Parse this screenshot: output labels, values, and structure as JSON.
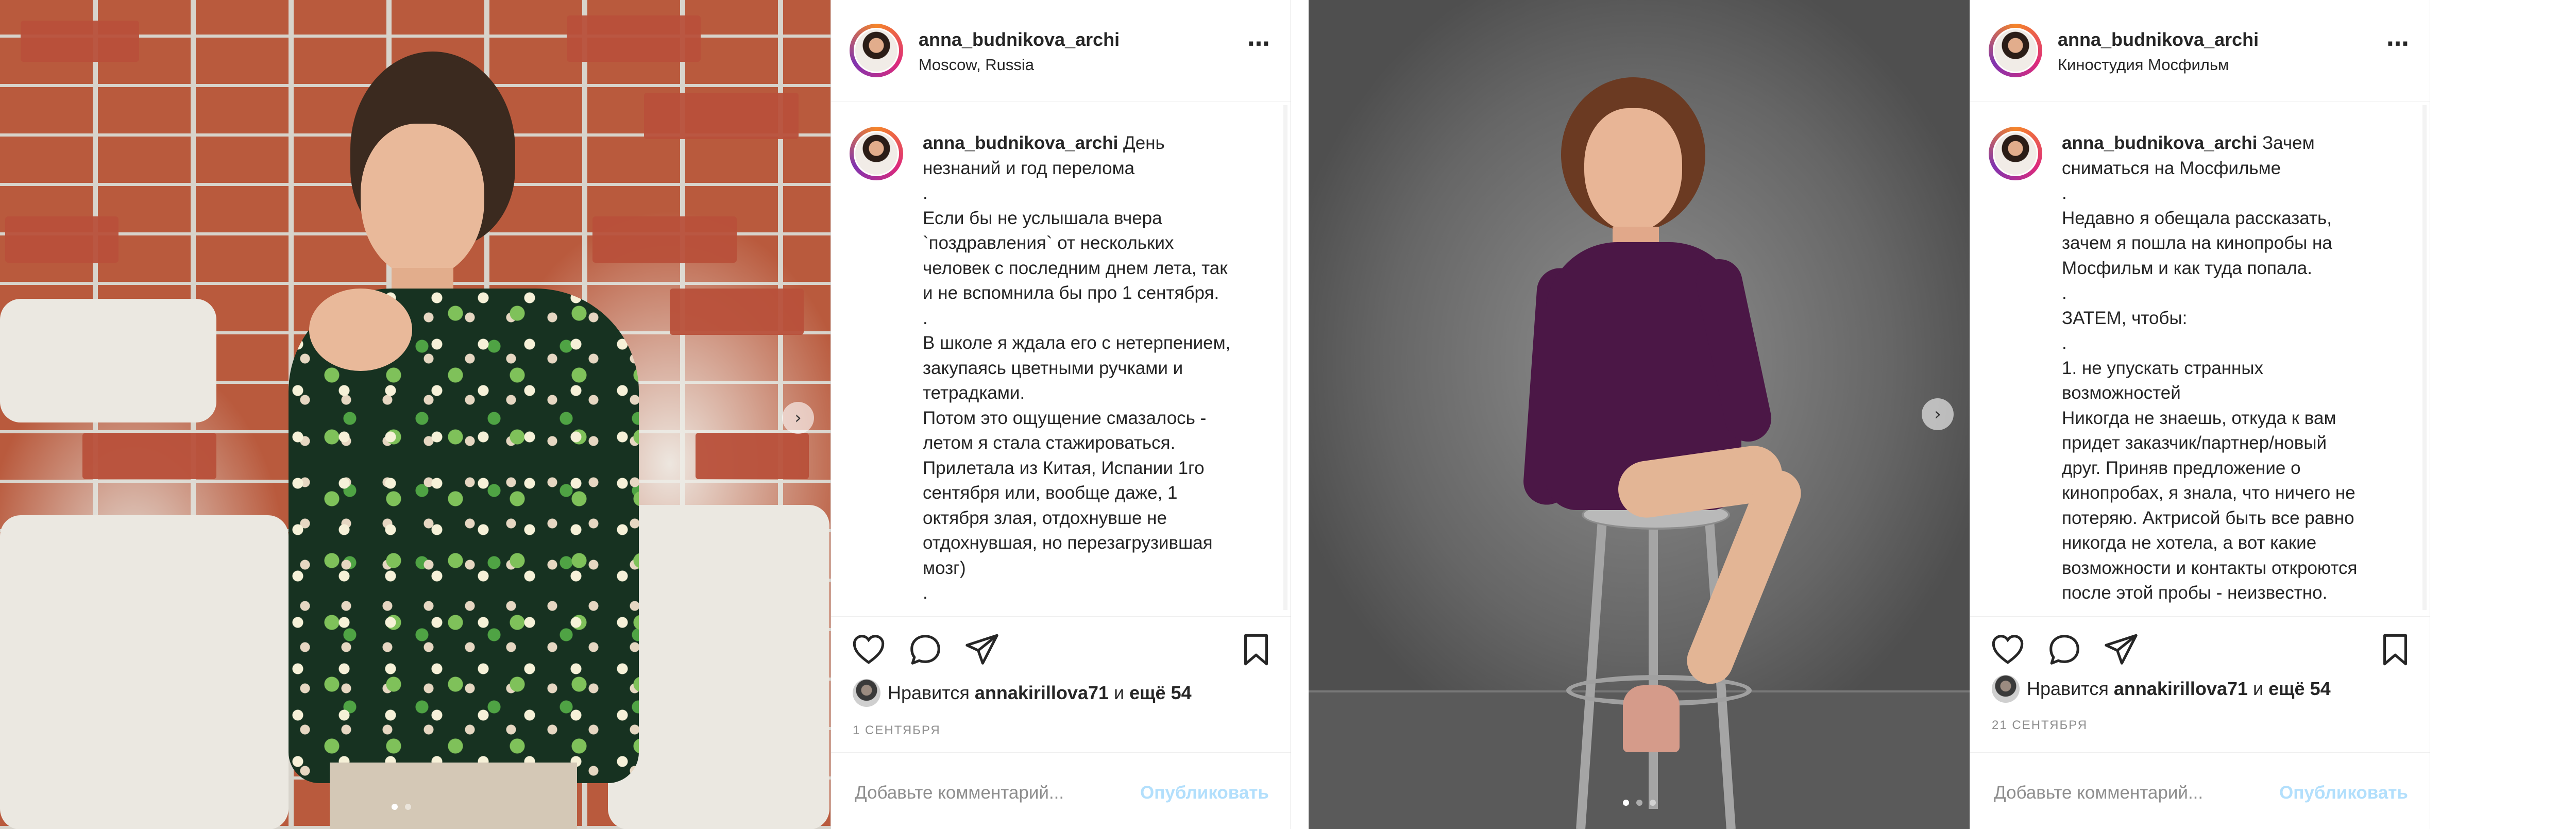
{
  "post1": {
    "username": "anna_budnikova_archi",
    "location": "Moscow, Russia",
    "more_icon": "⋯",
    "caption_username": "anna_budnikova_archi",
    "caption_lines": [
      "День",
      "незнаний и год перелома",
      ".",
      "Если бы не услышала вчера",
      "`поздравления` от нескольких",
      "человек с последним днем лета, так",
      "и не вспомнила бы про 1 сентября.",
      ".",
      "В школе я ждала его с нетерпением,",
      "закупаясь цветными ручками и",
      "тетрадками.",
      "Потом это ощущение смазалось -",
      "летом я стала стажироваться.",
      "Прилетала из Китая, Испании 1го",
      "сентября или, вообще даже, 1",
      "октября злая, отдохнувше не",
      "отдохнувшая, но перезагрузившая",
      "мозг)",
      "."
    ],
    "likes_prefix": "Нравится",
    "likes_user": "annakirillova71",
    "likes_mid": "и",
    "likes_more": "ещё 54",
    "date": "1 СЕНТЯБРЯ",
    "comment_placeholder": "Добавьте комментарий...",
    "publish_label": "Опубликовать"
  },
  "post2": {
    "username": "anna_budnikova_archi",
    "location": "Киностудия Мосфильм",
    "more_icon": "⋯",
    "caption_username": "anna_budnikova_archi",
    "caption_lines": [
      "Зачем",
      "сниматься на Мосфильме",
      ".",
      "Недавно я обещала рассказать,",
      "зачем я пошла на кинопробы на",
      "Мосфильм и как туда попала.",
      ".",
      "ЗАТЕМ, чтобы:",
      ".",
      "1. не упускать странных",
      "возможностей",
      "Никогда не знаешь, откуда к вам",
      "придет заказчик/партнер/новый",
      "друг. Приняв предложение о",
      "кинопробах, я знала, что ничего не",
      "потеряю. Актрисой быть все равно",
      "никогда не хотела, а вот какие",
      "возможности и контакты откроются",
      "после этой пробы - неизвестно."
    ],
    "likes_prefix": "Нравится",
    "likes_user": "annakirillova71",
    "likes_mid": "и",
    "likes_more": "ещё 54",
    "date": "21 СЕНТЯБРЯ",
    "comment_placeholder": "Добавьте комментарий...",
    "publish_label": "Опубликовать"
  },
  "icons": {
    "carousel_next": "›",
    "like": "heart-icon",
    "comment": "comment-icon",
    "share": "send-icon",
    "save": "bookmark-icon"
  },
  "colors": {
    "text": "#262626",
    "muted": "#8e8e8e",
    "publish_disabled": "#b2dffc",
    "border": "#dbdbdb"
  }
}
